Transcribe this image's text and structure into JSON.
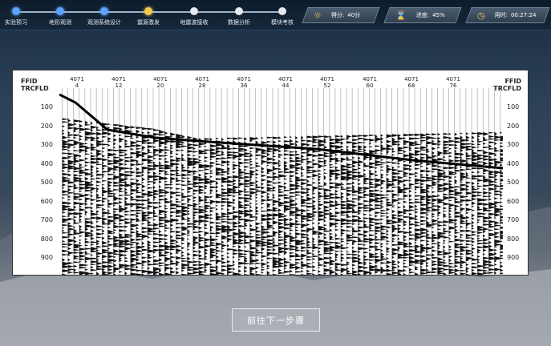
{
  "steps": [
    {
      "label": "实验预习",
      "status": "done"
    },
    {
      "label": "地形观测",
      "status": "done"
    },
    {
      "label": "观测系统设计",
      "status": "done"
    },
    {
      "label": "震源激发",
      "status": "current"
    },
    {
      "label": "地震波接收",
      "status": "todo"
    },
    {
      "label": "数据分析",
      "status": "todo"
    },
    {
      "label": "模块考核",
      "status": "todo"
    }
  ],
  "stats": {
    "score": {
      "icon": "person-score-icon",
      "label": "得分:",
      "value": "40分"
    },
    "progress": {
      "icon": "hourglass-icon",
      "label": "进度:",
      "value": "45%"
    },
    "time": {
      "icon": "clock-icon",
      "label": "用时:",
      "value": "00:27:24"
    }
  },
  "seismic": {
    "left_header": [
      "FFID",
      "TRCFLD"
    ],
    "right_header": [
      "FFID",
      "TRCFLD"
    ],
    "columns": [
      {
        "ffid": "4071",
        "trc": "4"
      },
      {
        "ffid": "4071",
        "trc": "12"
      },
      {
        "ffid": "4071",
        "trc": "20"
      },
      {
        "ffid": "4071",
        "trc": "28"
      },
      {
        "ffid": "4071",
        "trc": "36"
      },
      {
        "ffid": "4071",
        "trc": "44"
      },
      {
        "ffid": "4071",
        "trc": "52"
      },
      {
        "ffid": "4071",
        "trc": "60"
      },
      {
        "ffid": "4071",
        "trc": "68"
      },
      {
        "ffid": "4071",
        "trc": "76"
      }
    ],
    "time_ticks": [
      "100",
      "200",
      "300",
      "400",
      "500",
      "600",
      "700",
      "800",
      "900"
    ]
  },
  "next_button": "前往下一步骤",
  "colors": {
    "done": "#5ea1ff",
    "current": "#f2c94c",
    "todo": "#e6e9ee"
  }
}
